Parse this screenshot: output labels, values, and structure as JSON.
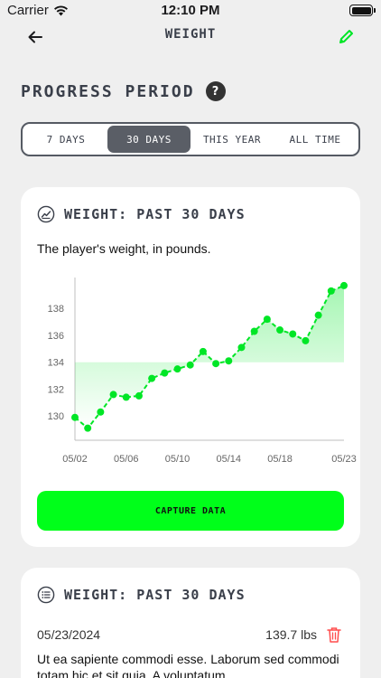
{
  "status_bar": {
    "carrier": "Carrier",
    "time": "12:10 PM"
  },
  "nav": {
    "title": "WEIGHT",
    "back_icon": "arrow-left-icon",
    "edit_icon": "pencil-icon",
    "accent": "#00e626"
  },
  "progress": {
    "title": "PROGRESS PERIOD",
    "help_label": "?",
    "segments": [
      "7 DAYS",
      "30 DAYS",
      "THIS YEAR",
      "ALL TIME"
    ],
    "selected": "30 DAYS"
  },
  "chart_card": {
    "title": "WEIGHT: PAST 30 DAYS",
    "icon": "line-chart-icon",
    "description": "The player's weight, in pounds.",
    "button_label": "CAPTURE DATA",
    "button_color": "#00ff1a"
  },
  "chart_data": {
    "type": "line",
    "x_ticks": [
      "05/02",
      "05/06",
      "05/10",
      "05/14",
      "05/18",
      "05/23"
    ],
    "y_ticks": [
      130,
      132,
      134,
      136,
      138
    ],
    "ylim": [
      128.2,
      140.3
    ],
    "xlim": [
      1,
      22
    ],
    "series": [
      {
        "color": "#00e626",
        "points": [
          [
            1,
            129.9
          ],
          [
            2,
            129.1
          ],
          [
            3,
            130.3
          ],
          [
            4,
            131.6
          ],
          [
            5,
            131.4
          ],
          [
            6,
            131.5
          ],
          [
            7,
            132.8
          ],
          [
            8,
            133.2
          ],
          [
            9,
            133.5
          ],
          [
            10,
            133.8
          ],
          [
            11,
            134.8
          ],
          [
            12,
            133.9
          ],
          [
            13,
            134.1
          ],
          [
            14,
            135.1
          ],
          [
            15,
            136.3
          ],
          [
            16,
            137.2
          ],
          [
            17,
            136.4
          ],
          [
            18,
            136.1
          ],
          [
            19,
            135.6
          ],
          [
            20,
            137.5
          ],
          [
            21,
            139.3
          ],
          [
            22,
            139.7
          ]
        ]
      }
    ],
    "grid": false
  },
  "log_card": {
    "title": "WEIGHT: PAST 30 DAYS",
    "icon": "list-icon",
    "entry": {
      "date": "05/23/2024",
      "value": "139.7 lbs",
      "note": "Ut ea sapiente commodi esse. Laborum sed commodi totam hic et sit quia. A voluptatum",
      "delete_icon": "trash-icon"
    }
  }
}
